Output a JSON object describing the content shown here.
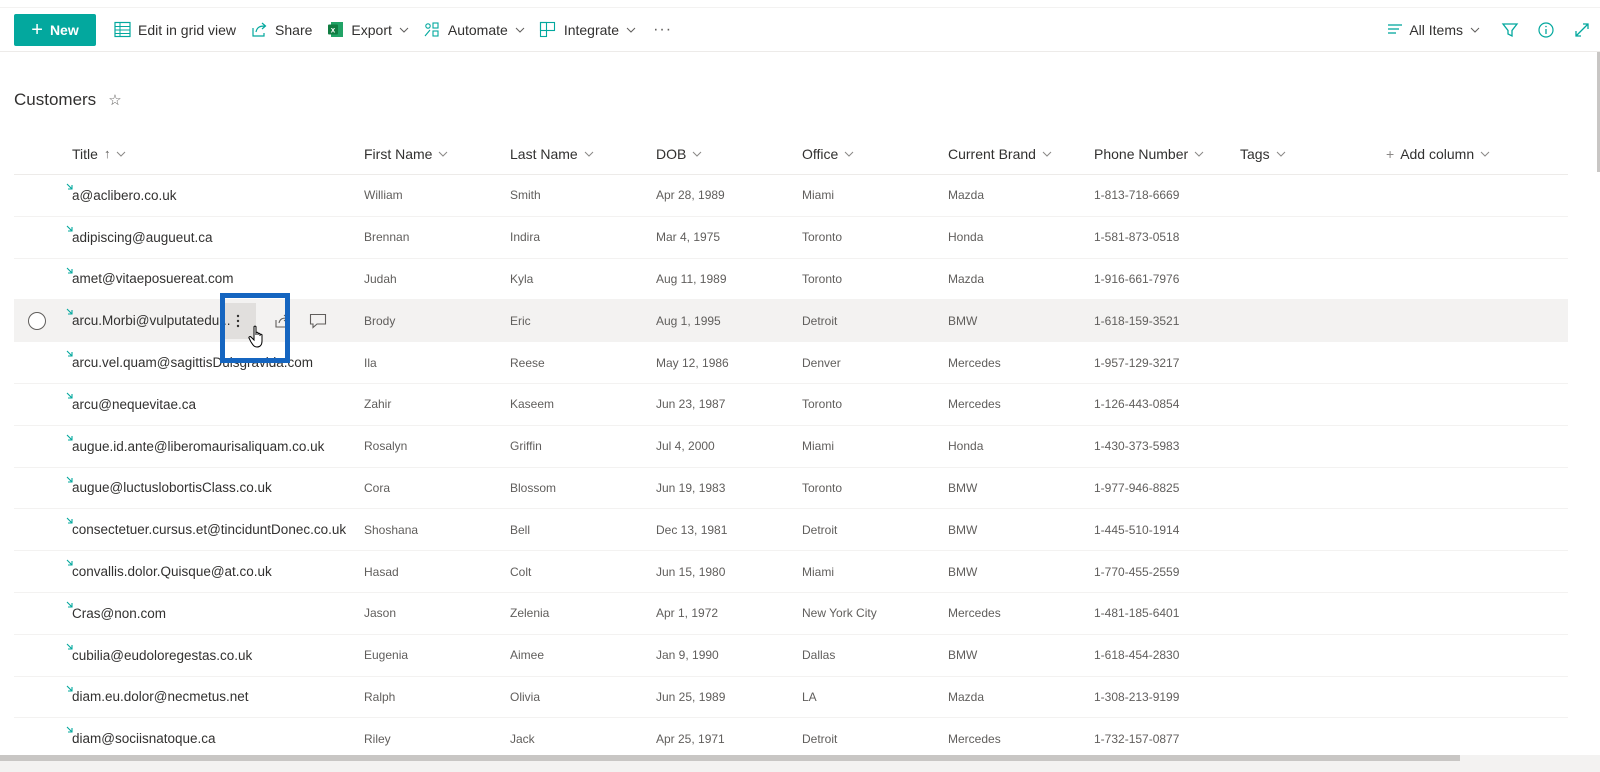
{
  "toolbar": {
    "new_label": "New",
    "edit_grid_label": "Edit in grid view",
    "share_label": "Share",
    "export_label": "Export",
    "automate_label": "Automate",
    "integrate_label": "Integrate",
    "more_label": "···",
    "view_label": "All Items"
  },
  "list": {
    "title": "Customers",
    "favorite_glyph": "☆"
  },
  "columns": {
    "title": "Title",
    "title_sort": "↑",
    "first_name": "First Name",
    "last_name": "Last Name",
    "dob": "DOB",
    "office": "Office",
    "brand": "Current Brand",
    "phone": "Phone Number",
    "tags": "Tags",
    "add_column": "Add column",
    "add_plus": "+"
  },
  "colors": {
    "accent": "#03a89e",
    "highlight": "#1565c0"
  },
  "rows": [
    {
      "title": "a@aclibero.co.uk",
      "first": "William",
      "last": "Smith",
      "dob": "Apr 28, 1989",
      "office": "Miami",
      "brand": "Mazda",
      "phone": "1-813-718-6669"
    },
    {
      "title": "adipiscing@augueut.ca",
      "first": "Brennan",
      "last": "Indira",
      "dob": "Mar 4, 1975",
      "office": "Toronto",
      "brand": "Honda",
      "phone": "1-581-873-0518"
    },
    {
      "title": "amet@vitaeposuereat.com",
      "first": "Judah",
      "last": "Kyla",
      "dob": "Aug 11, 1989",
      "office": "Toronto",
      "brand": "Mazda",
      "phone": "1-916-661-7976"
    },
    {
      "title": "arcu.Morbi@vulputatedu...",
      "first": "Brody",
      "last": "Eric",
      "dob": "Aug 1, 1995",
      "office": "Detroit",
      "brand": "BMW",
      "phone": "1-618-159-3521"
    },
    {
      "title": "arcu.vel.quam@sagittisDuisgravida.com",
      "first": "Ila",
      "last": "Reese",
      "dob": "May 12, 1986",
      "office": "Denver",
      "brand": "Mercedes",
      "phone": "1-957-129-3217"
    },
    {
      "title": "arcu@nequevitae.ca",
      "first": "Zahir",
      "last": "Kaseem",
      "dob": "Jun 23, 1987",
      "office": "Toronto",
      "brand": "Mercedes",
      "phone": "1-126-443-0854"
    },
    {
      "title": "augue.id.ante@liberomaurisaliquam.co.uk",
      "first": "Rosalyn",
      "last": "Griffin",
      "dob": "Jul 4, 2000",
      "office": "Miami",
      "brand": "Honda",
      "phone": "1-430-373-5983"
    },
    {
      "title": "augue@luctuslobortisClass.co.uk",
      "first": "Cora",
      "last": "Blossom",
      "dob": "Jun 19, 1983",
      "office": "Toronto",
      "brand": "BMW",
      "phone": "1-977-946-8825"
    },
    {
      "title": "consectetuer.cursus.et@tinciduntDonec.co.uk",
      "first": "Shoshana",
      "last": "Bell",
      "dob": "Dec 13, 1981",
      "office": "Detroit",
      "brand": "BMW",
      "phone": "1-445-510-1914"
    },
    {
      "title": "convallis.dolor.Quisque@at.co.uk",
      "first": "Hasad",
      "last": "Colt",
      "dob": "Jun 15, 1980",
      "office": "Miami",
      "brand": "BMW",
      "phone": "1-770-455-2559"
    },
    {
      "title": "Cras@non.com",
      "first": "Jason",
      "last": "Zelenia",
      "dob": "Apr 1, 1972",
      "office": "New York City",
      "brand": "Mercedes",
      "phone": "1-481-185-6401"
    },
    {
      "title": "cubilia@eudoloregestas.co.uk",
      "first": "Eugenia",
      "last": "Aimee",
      "dob": "Jan 9, 1990",
      "office": "Dallas",
      "brand": "BMW",
      "phone": "1-618-454-2830"
    },
    {
      "title": "diam.eu.dolor@necmetus.net",
      "first": "Ralph",
      "last": "Olivia",
      "dob": "Jun 25, 1989",
      "office": "LA",
      "brand": "Mazda",
      "phone": "1-308-213-9199"
    },
    {
      "title": "diam@sociisnatoque.ca",
      "first": "Riley",
      "last": "Jack",
      "dob": "Apr 25, 1971",
      "office": "Detroit",
      "brand": "Mercedes",
      "phone": "1-732-157-0877"
    }
  ],
  "hovered_row_index": 3
}
